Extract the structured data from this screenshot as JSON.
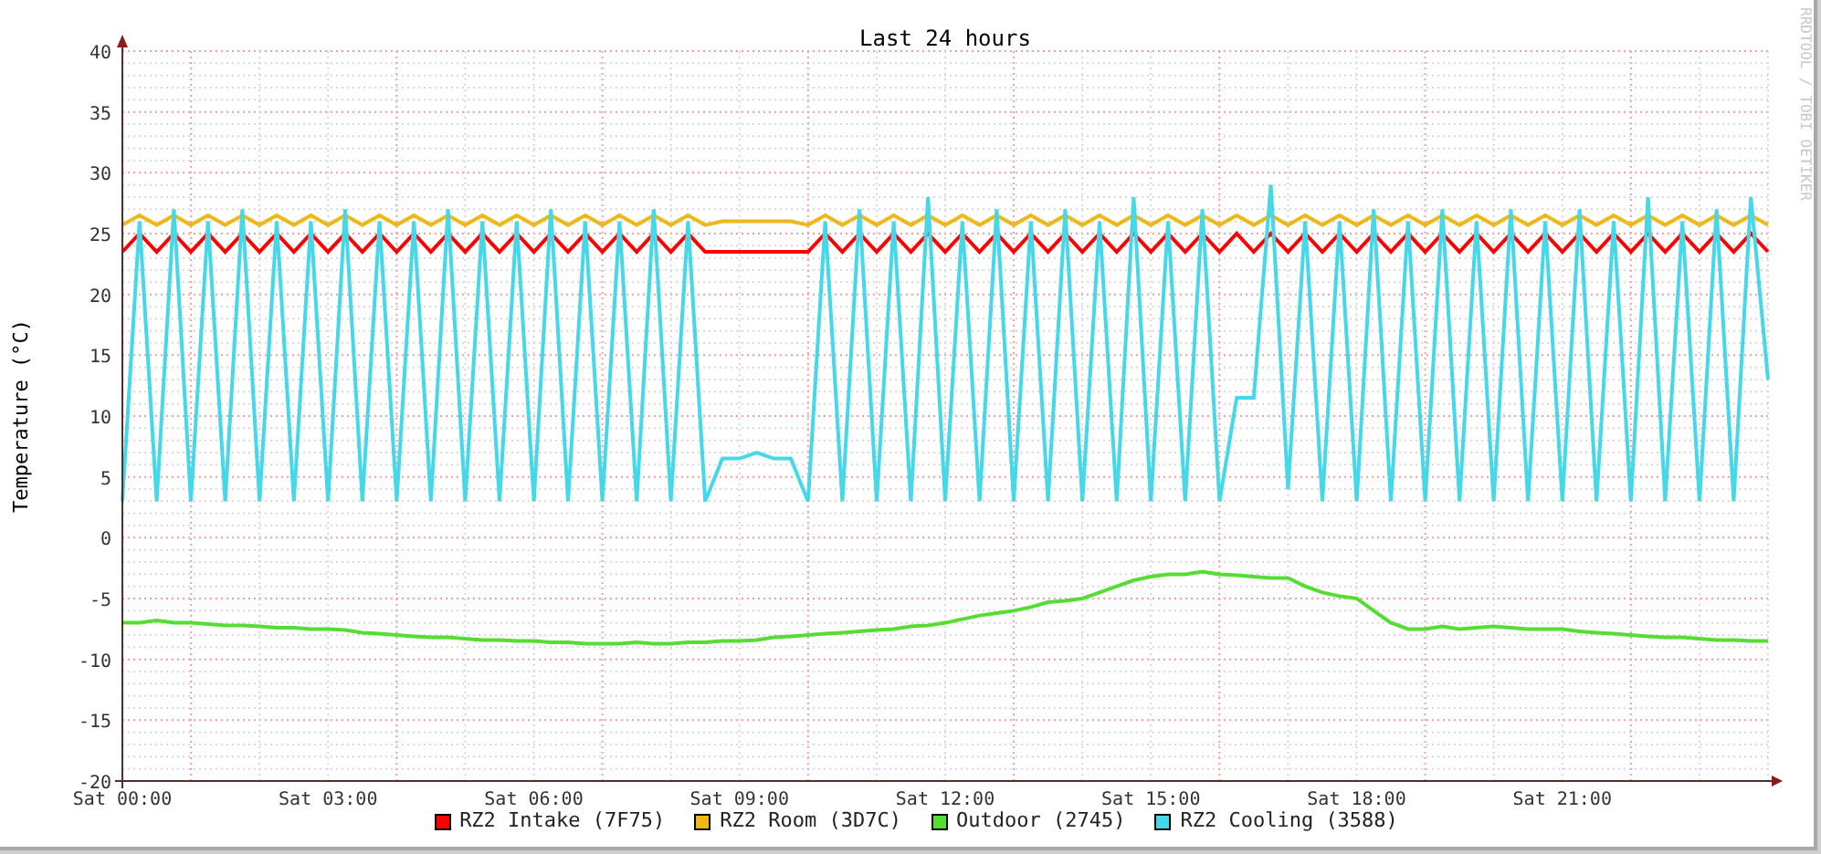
{
  "chart_data": {
    "type": "line",
    "grid": true,
    "title": "Last 24 hours",
    "ylabel": "Temperature (°C)",
    "ylim": [
      -20,
      40
    ],
    "yticks": [
      40,
      35,
      30,
      25,
      20,
      15,
      10,
      5,
      0,
      -5,
      -10,
      -15,
      -20
    ],
    "categories": [
      "Sat 00:00",
      null,
      null,
      null,
      null,
      null,
      null,
      null,
      null,
      null,
      null,
      null,
      "Sat 03:00",
      null,
      null,
      null,
      null,
      null,
      null,
      null,
      null,
      null,
      null,
      null,
      "Sat 06:00",
      null,
      null,
      null,
      null,
      null,
      null,
      null,
      null,
      null,
      null,
      null,
      "Sat 09:00",
      null,
      null,
      null,
      null,
      null,
      null,
      null,
      null,
      null,
      null,
      null,
      "Sat 12:00",
      null,
      null,
      null,
      null,
      null,
      null,
      null,
      null,
      null,
      null,
      null,
      "Sat 15:00",
      null,
      null,
      null,
      null,
      null,
      null,
      null,
      null,
      null,
      null,
      null,
      "Sat 18:00",
      null,
      null,
      null,
      null,
      null,
      null,
      null,
      null,
      null,
      null,
      null,
      "Sat 21:00",
      null,
      null,
      null,
      null,
      null,
      null,
      null,
      null,
      null,
      null,
      null,
      null
    ],
    "series": [
      {
        "name": "RZ2 Intake (7F75)",
        "color": "#ff0000",
        "values": [
          23.5,
          25,
          23.5,
          25,
          23.5,
          25,
          23.5,
          25,
          23.5,
          25,
          23.5,
          25,
          23.5,
          25,
          23.5,
          25,
          23.5,
          25,
          23.5,
          25,
          23.5,
          25,
          23.5,
          25,
          23.5,
          25,
          23.5,
          25,
          23.5,
          25,
          23.5,
          25,
          23.5,
          25,
          23.5,
          23.5,
          23.5,
          23.5,
          23.5,
          23.5,
          23.5,
          25,
          23.5,
          25,
          23.5,
          25,
          23.5,
          25,
          23.5,
          25,
          23.5,
          25,
          23.5,
          25,
          23.5,
          25,
          23.5,
          25,
          23.5,
          25,
          23.5,
          25,
          23.5,
          25,
          23.5,
          25,
          23.5,
          25,
          23.5,
          25,
          23.5,
          25,
          23.5,
          25,
          23.5,
          25,
          23.5,
          25,
          23.5,
          25,
          23.5,
          25,
          23.5,
          25,
          23.5,
          25,
          23.5,
          25,
          23.5,
          25,
          23.5,
          25,
          23.5,
          25,
          23.5,
          25,
          23.5
        ]
      },
      {
        "name": "RZ2 Room (3D7C)",
        "color": "#eeb818",
        "values": [
          25.7,
          26.5,
          25.7,
          26.5,
          25.7,
          26.5,
          25.7,
          26.5,
          25.7,
          26.5,
          25.7,
          26.5,
          25.7,
          26.5,
          25.7,
          26.5,
          25.7,
          26.5,
          25.7,
          26.5,
          25.7,
          26.5,
          25.7,
          26.5,
          25.7,
          26.5,
          25.7,
          26.5,
          25.7,
          26.5,
          25.7,
          26.5,
          25.7,
          26.5,
          25.7,
          26,
          26,
          26,
          26,
          26,
          25.7,
          26.5,
          25.7,
          26.5,
          25.7,
          26.5,
          25.7,
          26.5,
          25.7,
          26.5,
          25.7,
          26.5,
          25.7,
          26.5,
          25.7,
          26.5,
          25.7,
          26.5,
          25.7,
          26.5,
          25.7,
          26.5,
          25.7,
          26.5,
          25.7,
          26.5,
          25.7,
          26.5,
          25.7,
          26.5,
          25.7,
          26.5,
          25.7,
          26.5,
          25.7,
          26.5,
          25.7,
          26.5,
          25.7,
          26.5,
          25.7,
          26.5,
          25.7,
          26.5,
          25.7,
          26.5,
          25.7,
          26.5,
          25.7,
          26.5,
          25.7,
          26.5,
          25.7,
          26.5,
          25.7,
          26.5,
          25.7
        ]
      },
      {
        "name": "Outdoor (2745)",
        "color": "#55dd33",
        "values": [
          -7,
          -7,
          -6.8,
          -7,
          -7,
          -7.1,
          -7.2,
          -7.2,
          -7.3,
          -7.4,
          -7.4,
          -7.5,
          -7.5,
          -7.6,
          -7.8,
          -7.9,
          -8,
          -8.1,
          -8.2,
          -8.2,
          -8.3,
          -8.4,
          -8.4,
          -8.5,
          -8.5,
          -8.6,
          -8.6,
          -8.7,
          -8.7,
          -8.7,
          -8.6,
          -8.7,
          -8.7,
          -8.6,
          -8.6,
          -8.5,
          -8.5,
          -8.4,
          -8.2,
          -8.1,
          -8,
          -7.9,
          -7.8,
          -7.7,
          -7.6,
          -7.5,
          -7.3,
          -7.2,
          -7,
          -6.7,
          -6.4,
          -6.2,
          -6,
          -5.7,
          -5.3,
          -5.2,
          -5,
          -4.5,
          -4,
          -3.5,
          -3.2,
          -3,
          -3,
          -2.8,
          -3,
          -3.1,
          -3.2,
          -3.3,
          -3.3,
          -4,
          -4.5,
          -4.8,
          -5,
          -6,
          -7,
          -7.5,
          -7.5,
          -7.3,
          -7.5,
          -7.4,
          -7.3,
          -7.4,
          -7.5,
          -7.5,
          -7.5,
          -7.7,
          -7.8,
          -7.9,
          -8,
          -8.1,
          -8.2,
          -8.2,
          -8.3,
          -8.4,
          -8.4,
          -8.5,
          -8.5
        ]
      },
      {
        "name": "RZ2 Cooling (3588)",
        "color": "#44d8e8",
        "values": [
          3,
          26,
          3,
          27,
          3,
          26,
          3,
          27,
          3,
          26,
          3,
          26,
          3,
          27,
          3,
          26,
          3,
          26,
          3,
          27,
          3,
          26,
          3,
          26,
          3,
          27,
          3,
          26,
          3,
          26,
          3,
          27,
          3,
          26,
          3,
          6.5,
          6.5,
          7,
          6.5,
          6.5,
          3,
          26,
          3,
          27,
          3,
          26,
          3,
          28,
          3,
          26,
          3,
          27,
          3,
          26,
          3,
          27,
          3,
          26,
          3,
          28,
          3,
          26,
          3,
          27,
          3,
          11.5,
          11.5,
          29,
          4,
          26,
          3,
          26,
          3,
          27,
          3,
          26,
          3,
          27,
          3,
          26,
          3,
          27,
          3,
          26,
          3,
          27,
          3,
          26,
          3,
          28,
          3,
          26,
          3,
          27,
          3,
          28,
          13
        ]
      }
    ]
  },
  "watermark_text": "RRDTOOL / TOBI OETIKER"
}
